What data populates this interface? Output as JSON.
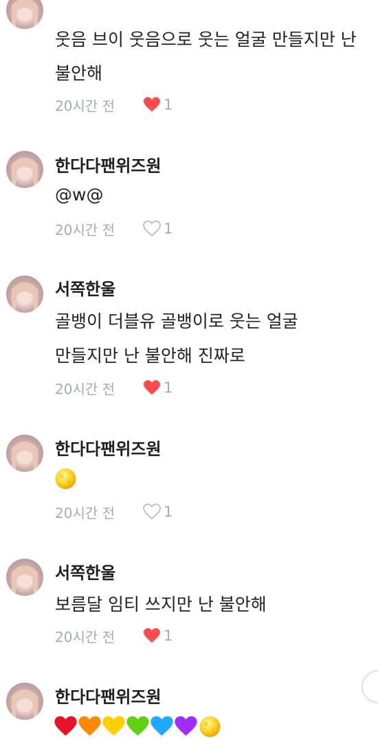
{
  "colors": {
    "liked_heart": "#ff4b4b",
    "empty_heart": "#b9bdc7",
    "meta_text": "#a4aab6"
  },
  "comments": [
    {
      "username": "",
      "lines": [
        "웃음 브이 웃음으로 웃는 얼굴 만들지만 난",
        "불안해"
      ],
      "time": "20시간 전",
      "liked": true,
      "like_count": "1"
    },
    {
      "username": "한다다팬위즈원",
      "lines": [
        "@w@"
      ],
      "time": "20시간 전",
      "liked": false,
      "like_count": "1"
    },
    {
      "username": "서쪽한울",
      "lines": [
        "골뱅이 더블유 골뱅이로 웃는 얼굴",
        "만들지만 난 불안해 진짜로"
      ],
      "time": "20시간 전",
      "liked": true,
      "like_count": "1"
    },
    {
      "username": "한다다팬위즈원",
      "emojis": [
        "full-moon-emoji"
      ],
      "time": "20시간 전",
      "liked": false,
      "like_count": "1"
    },
    {
      "username": "서쪽한울",
      "lines": [
        "보름달 임티 쓰지만 난 불안해"
      ],
      "time": "20시간 전",
      "liked": true,
      "like_count": "1"
    },
    {
      "username": "한다다팬위즈원",
      "emojis": [
        "red-heart-emoji",
        "orange-heart-emoji",
        "yellow-heart-emoji",
        "green-heart-emoji",
        "blue-heart-emoji",
        "purple-heart-emoji",
        "full-moon-emoji"
      ]
    }
  ]
}
